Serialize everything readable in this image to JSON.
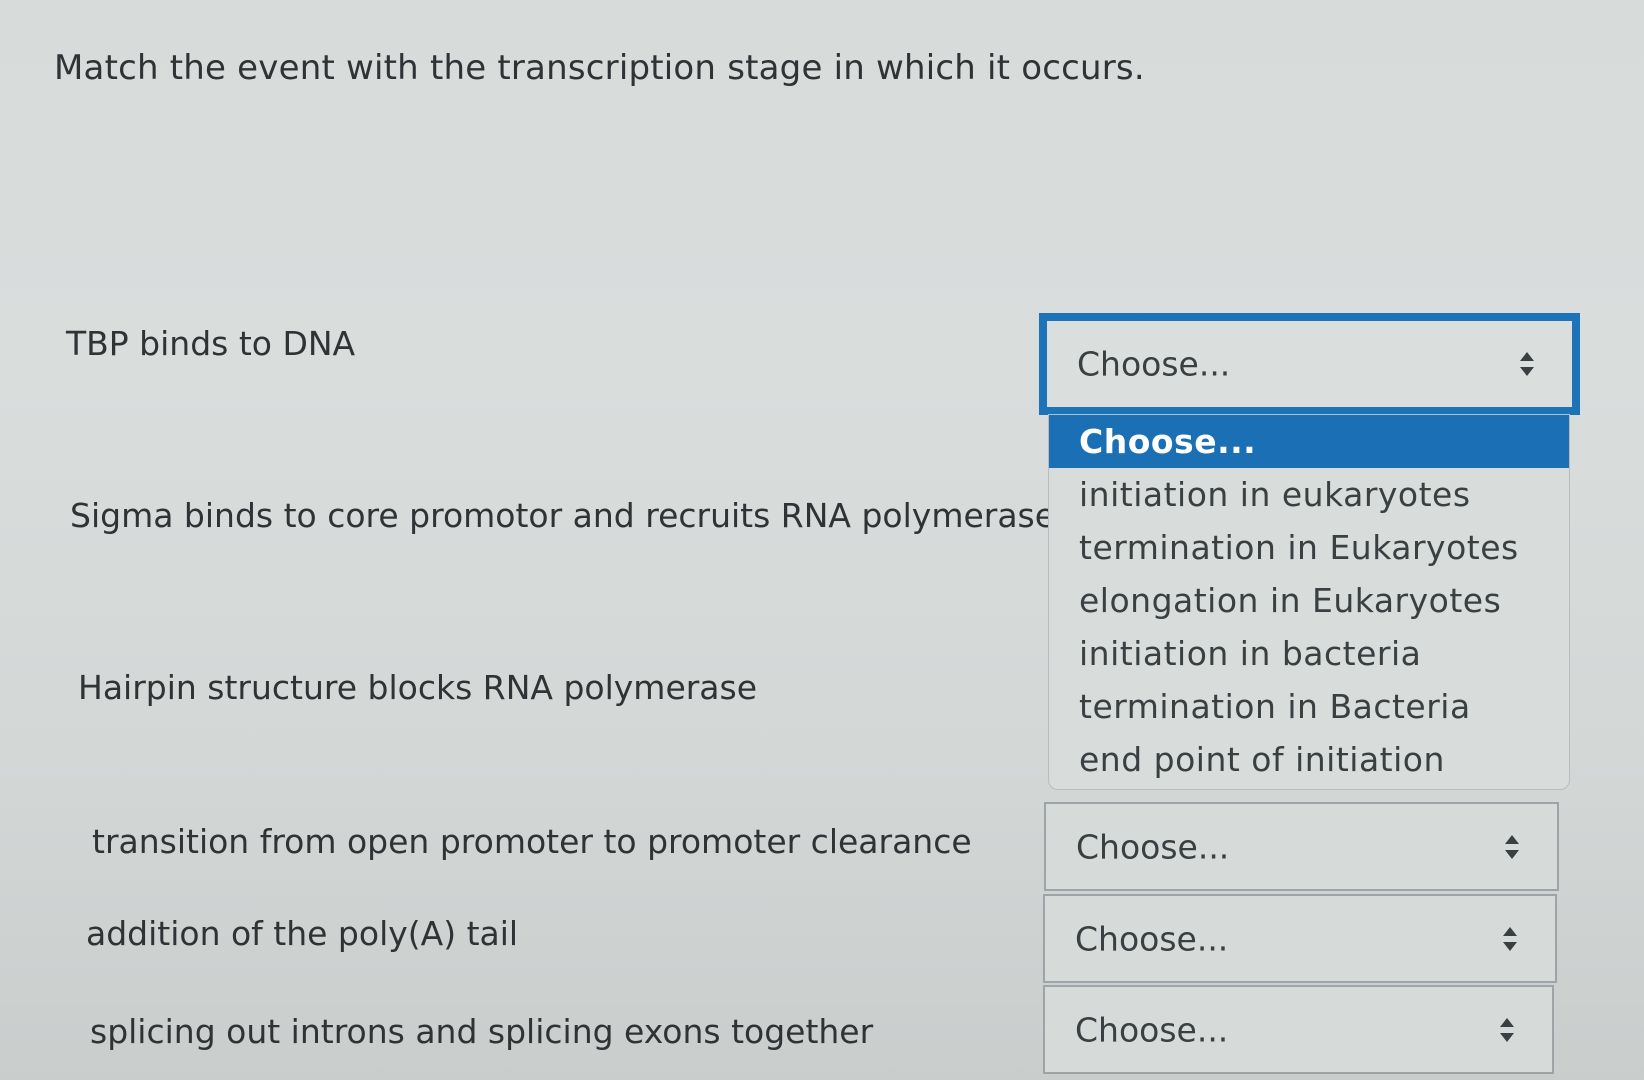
{
  "question": "Match the event with the transcription stage in which it occurs.",
  "rows": [
    {
      "event": "TBP binds to DNA",
      "selected": "Choose..."
    },
    {
      "event": "Sigma binds to core promotor and recruits RNA polymerase"
    },
    {
      "event": "Hairpin structure blocks RNA polymerase"
    },
    {
      "event": "transition from open promoter to promoter clearance",
      "selected": "Choose..."
    },
    {
      "event": "addition of the poly(A) tail",
      "selected": "Choose..."
    },
    {
      "event": "splicing out introns and splicing exons together",
      "selected": "Choose..."
    }
  ],
  "dropdown": {
    "options": [
      "Choose...",
      "initiation in eukaryotes",
      "termination in Eukaryotes",
      "elongation in Eukaryotes",
      "initiation in bacteria",
      "termination in Bacteria",
      "end point of initiation"
    ],
    "highlighted_index": 0
  },
  "colors": {
    "focus_border": "#1d73b8",
    "highlight": "#1b6fb5",
    "background": "#d7dbda"
  }
}
